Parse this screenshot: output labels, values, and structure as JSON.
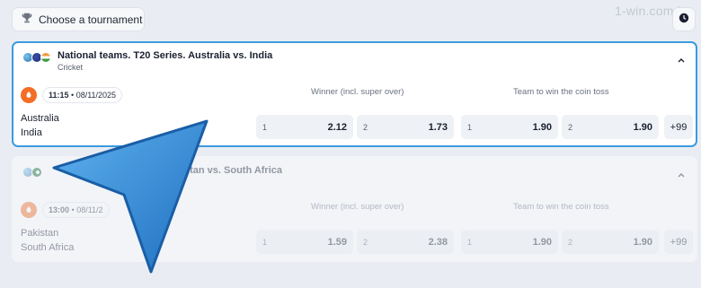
{
  "header": {
    "tournament_button": "Choose a tournament",
    "watermark": "1-win.com.in"
  },
  "events": [
    {
      "title": "National teams. T20 Series. Australia vs. India",
      "sport": "Cricket",
      "time": "11:15",
      "date": "08/11/2025",
      "team1": "Australia",
      "team2": "India",
      "market1": "Winner (incl. super over)",
      "market2": "Team to win the coin toss",
      "odds": [
        {
          "label": "1",
          "value": "2.12"
        },
        {
          "label": "2",
          "value": "1.73"
        },
        {
          "label": "1",
          "value": "1.90"
        },
        {
          "label": "2",
          "value": "1.90"
        }
      ],
      "more": "+99"
    },
    {
      "title": "stan vs. South Africa",
      "time": "13:00",
      "date": "08/11/2",
      "team1": "Pakistan",
      "team2": "South Africa",
      "market1": "Winner (incl. super over)",
      "market2": "Team to win the coin toss",
      "odds": [
        {
          "label": "1",
          "value": "1.59"
        },
        {
          "label": "2",
          "value": "2.38"
        },
        {
          "label": "1",
          "value": "1.90"
        },
        {
          "label": "2",
          "value": "1.90"
        }
      ],
      "more": "+99"
    }
  ],
  "colors": {
    "accent_border": "#3b9bde",
    "cursor_blue": "#2f86d6",
    "sport_icon": "#f46d25"
  },
  "icons": [
    "trophy-icon",
    "clock-icon",
    "chevron-up-icon",
    "cricket-icon",
    "pointer-cursor-icon"
  ]
}
